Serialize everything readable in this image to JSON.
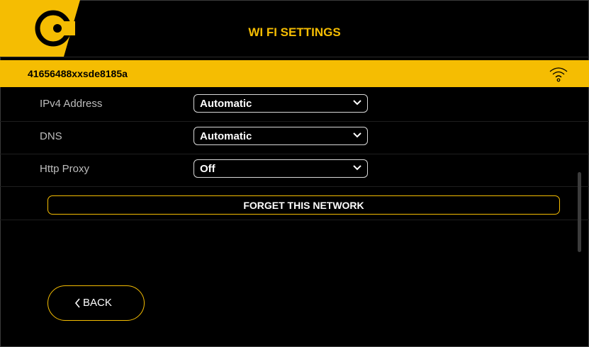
{
  "header": {
    "title": "WI FI SETTINGS",
    "logo_icon": "brand-c-logo-icon"
  },
  "network": {
    "ssid": "41656488xxsde8185a",
    "signal_icon": "wifi-icon"
  },
  "settings": [
    {
      "label": "IPv4 Address",
      "value": "Automatic"
    },
    {
      "label": "DNS",
      "value": "Automatic"
    },
    {
      "label": "Http Proxy",
      "value": "Off"
    }
  ],
  "actions": {
    "forget_label": "FORGET THIS NETWORK",
    "back_label": "BACK"
  },
  "colors": {
    "accent": "#f5bd02",
    "background": "#000000",
    "text": "#ffffff"
  }
}
